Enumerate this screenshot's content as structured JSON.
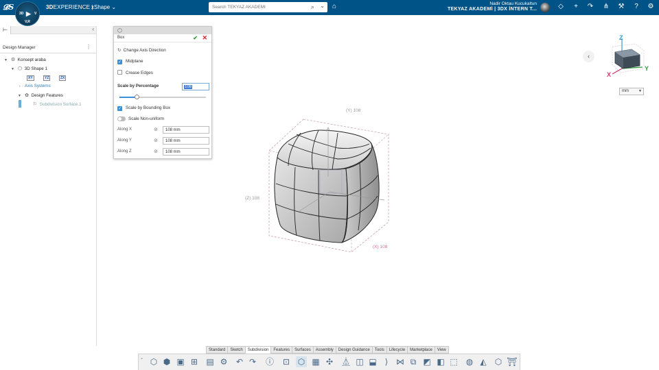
{
  "topbar": {
    "brand_bold": "3D",
    "brand_rest": "EXPERIENCE",
    "separator": "|",
    "app_name": "xShape",
    "search_placeholder": "Search TEKYAZ AKADEMI",
    "user_name": "Nadir Oktau Kucukaltun",
    "tenant": "TEKYAZ AKADEMİ | 3DX İNTERN T...",
    "compass_labels": {
      "left": "3D",
      "right": "V",
      "bottom": "V,R"
    }
  },
  "left_panel": {
    "title": "Design Manager",
    "tree": {
      "root": "Konsept araba",
      "shape": "3D Shape 1",
      "planes": [
        "XY",
        "YZ",
        "ZX"
      ],
      "axis": "Axis Systems",
      "features": "Design Features",
      "surface": "Subdivision Surface.1"
    }
  },
  "dialog": {
    "title": "Box",
    "change_axis": "Change Axis Direction",
    "midplane": "Midplane",
    "midplane_checked": true,
    "crease": "Crease Edges",
    "crease_checked": false,
    "scale_label": "Scale by Percentage",
    "scale_value": "108",
    "slider_fraction": 0.2,
    "bbox_label": "Scale by Bounding Box",
    "bbox_checked": true,
    "nonuniform_label": "Scale Non-uniform",
    "along": [
      {
        "label": "Along X",
        "value": "108 mm"
      },
      {
        "label": "Along Y",
        "value": "108 mm"
      },
      {
        "label": "Along Z",
        "value": "108 mm"
      }
    ]
  },
  "viewport": {
    "dim_y": "(Y) 108",
    "dim_z": "(Z) 108",
    "dim_x": "(X) 108",
    "axis_labels": {
      "z": "Z",
      "x": "X",
      "y": "Y"
    },
    "units": "mm",
    "colors": {
      "z_axis": "#2a9bd6",
      "x_axis": "#d6336c",
      "y_axis": "#2e9b3a"
    }
  },
  "bottom": {
    "tabs": [
      "Standard",
      "Sketch",
      "Subdivision",
      "Features",
      "Surfaces",
      "Assembly",
      "Design Guidance",
      "Tools",
      "Lifecycle",
      "Marketplace",
      "View"
    ],
    "active_tab": "Subdivision"
  }
}
